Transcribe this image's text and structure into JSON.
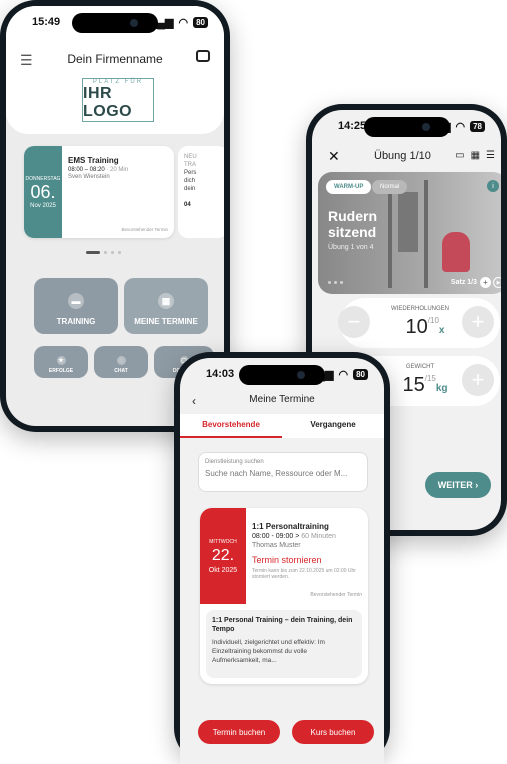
{
  "phoneA": {
    "status_time": "15:49",
    "battery": "80",
    "title": "Dein Firmenname",
    "logo_small": "PLATZ FÜR",
    "logo_big": "IHR LOGO",
    "card": {
      "weekday": "DONNERSTAG",
      "day": "06.",
      "month": "Nov 2025",
      "title": "EMS Training",
      "time": "08:00 – 08:20",
      "duration": " · 20 Min",
      "trainer": "Sven Wienstein",
      "badge": "Bevorstehender Termin"
    },
    "peek": {
      "l1": "NEU",
      "l2": "TRA",
      "l3": "Pers",
      "l4": "dich",
      "l5": "dein",
      "num": "04"
    },
    "tiles": {
      "training": "TRAINING",
      "termine": "MEINE TERMINE",
      "erfolge": "ERFOLGE",
      "chat": "CHAT",
      "doku": "DOKUME"
    }
  },
  "phoneB": {
    "status_time": "14:25",
    "battery": "78",
    "title": "Übung 1/10",
    "pill_warmup": "WARM-UP",
    "pill_normal": "Normal",
    "exercise_line1": "Rudern",
    "exercise_line2": "sitzend",
    "exercise_sub": "Übung 1 von 4",
    "satz": "Satz 1/3",
    "wh_label": "WIEDERHOLUNGEN",
    "wh_value": "10",
    "wh_total": "/10",
    "wh_unit": "x",
    "gw_label": "GEWICHT",
    "gw_value": "15",
    "gw_total": "/15",
    "gw_unit": "kg",
    "next_button": "WEITER ›"
  },
  "phoneC": {
    "status_time": "14:03",
    "battery": "80",
    "title": "Meine Termine",
    "tab_upcoming": "Bevorstehende",
    "tab_past": "Vergangene",
    "search_label": "Dienstleistung suchen",
    "search_placeholder": "Suche nach Name, Ressource oder M...",
    "card": {
      "weekday": "MITTWOCH",
      "day": "22.",
      "month": "Okt 2025",
      "title": "1:1 Personaltraining",
      "time": "08:00 - 09:00 >",
      "duration": " 60 Minuten",
      "trainer": "Thomas  Muster",
      "cancel": "Termin stornieren",
      "note": "Termin kann bis zum 22.10.2025 um 02:00 Uhr storniert werden.",
      "badge": "Bevorstehender Termin",
      "desc_title": "1:1 Personal Training – dein Training, dein Tempo",
      "desc_text": "Individuell, zielgerichtet und effektiv: Im Einzeltraining bekommst du volle Aufmerksamkeit, ma..."
    },
    "btn_termin": "Termin buchen",
    "btn_kurs": "Kurs buchen"
  }
}
